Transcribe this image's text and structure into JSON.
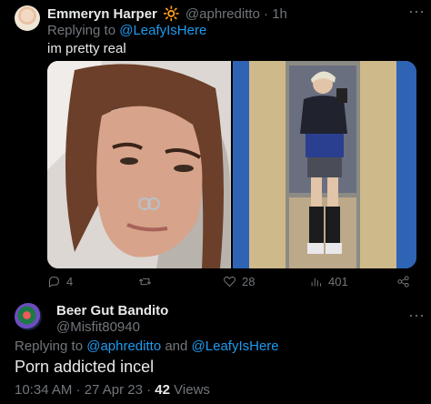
{
  "tweet1": {
    "name": "Emmeryn Harper",
    "emoji": "🔆",
    "handle": "@aphreditto",
    "sep": "·",
    "time": "1h",
    "replying_prefix": "Replying to",
    "replying_to": "@LeafyIsHere",
    "text": "im pretty real",
    "actions": {
      "replies": "4",
      "retweets": "",
      "likes": "28",
      "views": "401"
    }
  },
  "tweet2": {
    "name": "Beer Gut Bandito",
    "handle": "@Misfit80940",
    "replying_prefix": "Replying to",
    "replying_to_1": "@aphreditto",
    "and": "and",
    "replying_to_2": "@LeafyIsHere",
    "text": "Porn addicted incel",
    "time": "10:34 AM",
    "date": "27 Apr 23",
    "views_count": "42",
    "views_label": "Views"
  },
  "icons": [
    "more-icon",
    "reply-icon",
    "retweet-icon",
    "like-icon",
    "views-icon",
    "share-icon"
  ],
  "colors": {
    "link": "#1d9bf0",
    "muted": "#71767b",
    "text": "#e7e9ea",
    "background": "#000000"
  }
}
